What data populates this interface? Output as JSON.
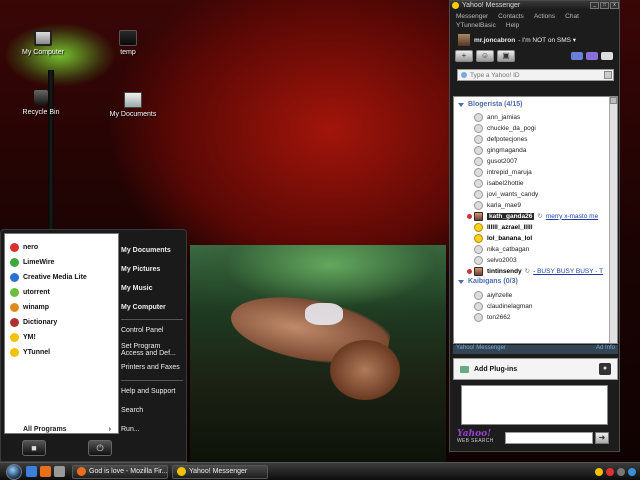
{
  "desktop": {
    "icons": [
      {
        "label": "My Computer",
        "icon": "computer-icon"
      },
      {
        "label": "temp",
        "icon": "folder-icon"
      },
      {
        "label": "Recycle Bin",
        "icon": "recycle-bin-icon"
      },
      {
        "label": "My Documents",
        "icon": "documents-icon"
      }
    ]
  },
  "start_menu": {
    "pinned": [
      {
        "label": "nero",
        "color": "#d8302a"
      },
      {
        "label": "LimeWire",
        "color": "#3da83d"
      },
      {
        "label": "Creative Media Lite",
        "color": "#2a6fd1"
      },
      {
        "label": "utorrent",
        "color": "#6bbf3a"
      },
      {
        "label": "winamp",
        "color": "#e08a1a"
      },
      {
        "label": "Dictionary",
        "color": "#b03030"
      },
      {
        "label": "YM!",
        "color": "#f2c200"
      },
      {
        "label": "YTunnel",
        "color": "#f2c200"
      }
    ],
    "all_programs": "All Programs",
    "all_programs_arrow": "›",
    "right": {
      "my_documents": "My Documents",
      "my_pictures": "My Pictures",
      "my_music": "My Music",
      "my_computer": "My Computer",
      "control_panel": "Control Panel",
      "set_program_1": "Set Program",
      "set_program_2": "Access and Def...",
      "printers": "Printers and Faxes",
      "help": "Help and Support",
      "search": "Search",
      "run": "Run..."
    },
    "lock_icon": "lock-icon",
    "power_icon": "power-icon"
  },
  "taskbar": {
    "tasks": [
      {
        "label": "God is love - Mozilla Fir...",
        "icon": "firefox-icon",
        "color": "#e8701a"
      },
      {
        "label": "Yahoo! Messenger",
        "icon": "yahoo-messenger-icon",
        "color": "#f2c200"
      }
    ],
    "tray_colors": [
      "#f2c200",
      "#e03030",
      "#777777",
      "#3a8fd8"
    ]
  },
  "messenger": {
    "title": "Yahoo! Messenger",
    "menu": [
      "Messenger",
      "Contacts",
      "Actions",
      "Chat",
      "YTunnelBasic",
      "Help"
    ],
    "user_name": "mr.joncabron",
    "user_status": " - I'm NOT on SMS ▾",
    "search_placeholder": "Type a Yahoo! ID",
    "groups": [
      {
        "name": "Blogerista (4/15)",
        "contacts": [
          {
            "name": "ann_jamias",
            "online": false
          },
          {
            "name": "chuckie_da_pogi",
            "online": false
          },
          {
            "name": "defpotecjones",
            "online": false
          },
          {
            "name": "gingmaganda",
            "online": false
          },
          {
            "name": "gusot2007",
            "online": false
          },
          {
            "name": "intrepid_maruja",
            "online": false
          },
          {
            "name": "isabel2hottie",
            "online": false
          },
          {
            "name": "jovi_wants_candy",
            "online": false
          },
          {
            "name": "karla_mae9",
            "online": false
          },
          {
            "name": "kath_ganda26",
            "online": true,
            "selected": true,
            "avatar": true,
            "message": "merry x-masto me"
          },
          {
            "name": "llllll_azrael_lllll",
            "online": true
          },
          {
            "name": "lol_banana_lol",
            "online": true
          },
          {
            "name": "nika_catbagan",
            "online": false
          },
          {
            "name": "selvo2003",
            "online": false
          },
          {
            "name": "tintinsendy",
            "online": true,
            "avatar": true,
            "message": "- BUSY BUSY BUSY - T"
          }
        ]
      },
      {
        "name": "Kaibigans (0/3)",
        "contacts": [
          {
            "name": "aiyhzelle",
            "online": false
          },
          {
            "name": "claudinelagman",
            "online": false
          },
          {
            "name": "ton2662",
            "online": false
          }
        ]
      }
    ],
    "bar_left": "Yahoo! Messenger",
    "bar_right": "Ad Info",
    "plugins_label": "Add Plug-ins",
    "web_logo": "Yahoo!",
    "web_search_label": "WEB SEARCH",
    "go_arrow": "➜"
  }
}
